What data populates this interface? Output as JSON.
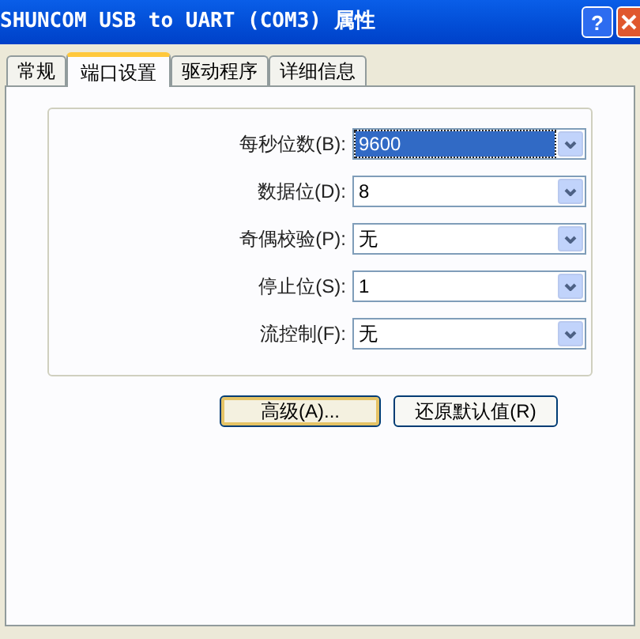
{
  "window": {
    "title": "SHUNCOM USB to UART (COM3) 属性",
    "help_button": "?"
  },
  "tabs": [
    {
      "label": "常规",
      "selected": false
    },
    {
      "label": "端口设置",
      "selected": true
    },
    {
      "label": "驱动程序",
      "selected": false
    },
    {
      "label": "详细信息",
      "selected": false
    }
  ],
  "settings": [
    {
      "label": "每秒位数(B):",
      "value": "9600",
      "focused": true
    },
    {
      "label": "数据位(D):",
      "value": "8",
      "focused": false
    },
    {
      "label": "奇偶校验(P):",
      "value": "无",
      "focused": false
    },
    {
      "label": "停止位(S):",
      "value": "1",
      "focused": false
    },
    {
      "label": "流控制(F):",
      "value": "无",
      "focused": false
    }
  ],
  "buttons": [
    {
      "label": "高级(A)...",
      "default": true
    },
    {
      "label": "还原默认值(R)",
      "default": false
    }
  ]
}
